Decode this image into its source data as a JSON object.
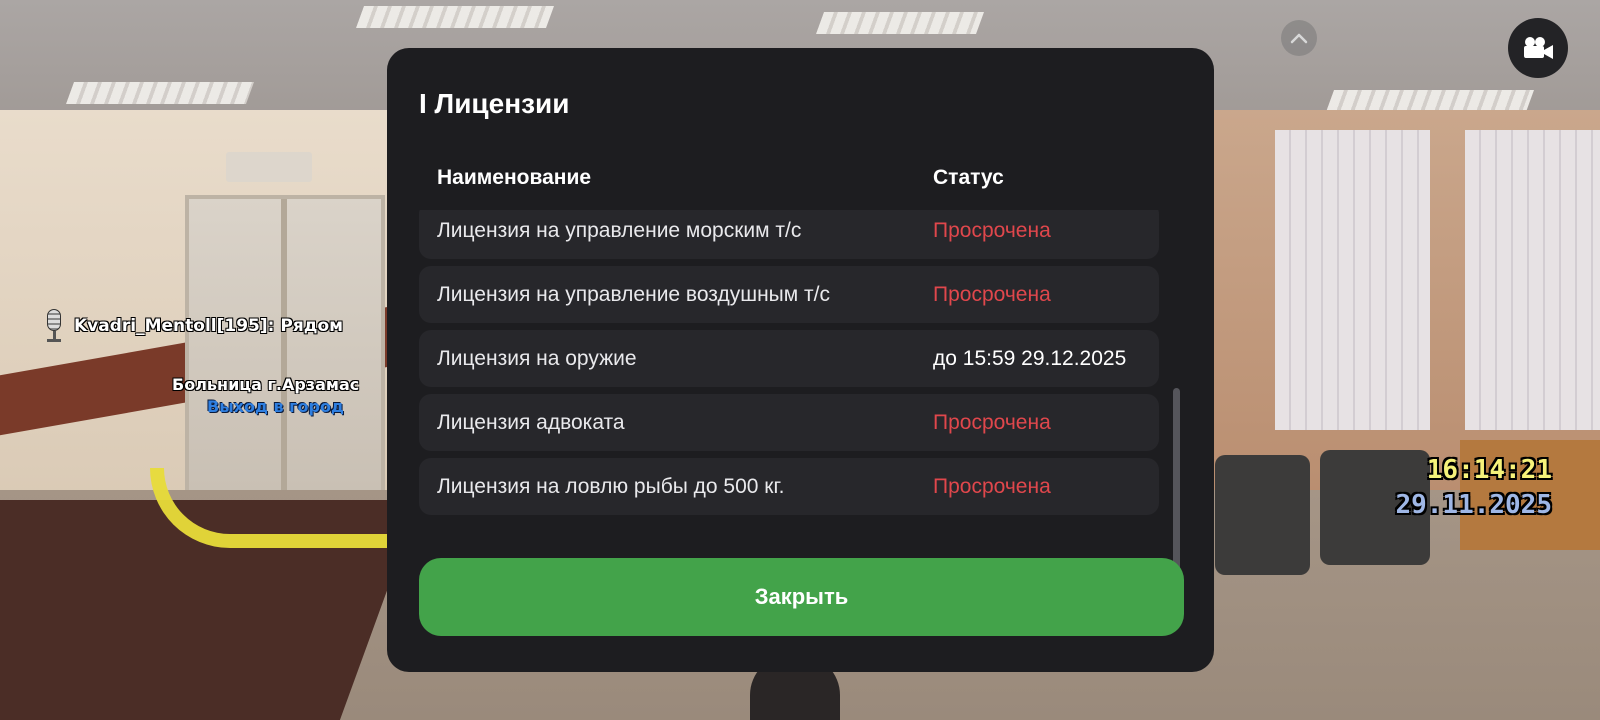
{
  "hud": {
    "player_label": "Kvadri_Mentoll[195]: Рядом",
    "location": "Больница г.Арзамас",
    "exit_label": "Выход в город",
    "time": "16:14:21",
    "date": "29.11.2025",
    "icons": {
      "mic": "microphone-icon",
      "chevron": "chevron-up-icon",
      "camera": "video-camera-icon"
    }
  },
  "modal": {
    "title": "I Лицензии",
    "headers": {
      "name": "Наименование",
      "status": "Статус"
    },
    "rows": [
      {
        "name": "Лицензия на управление морским т/с",
        "status": "Просрочена",
        "expired": true
      },
      {
        "name": "Лицензия на управление воздушным т/с",
        "status": "Просрочена",
        "expired": true
      },
      {
        "name": "Лицензия на оружие",
        "status": "до 15:59 29.12.2025",
        "expired": false
      },
      {
        "name": "Лицензия адвоката",
        "status": "Просрочена",
        "expired": true
      },
      {
        "name": "Лицензия на ловлю рыбы до 500 кг.",
        "status": "Просрочена",
        "expired": true
      }
    ],
    "close_label": "Закрыть"
  },
  "colors": {
    "expired": "#e0474c",
    "valid": "#ffffff",
    "close_button": "#43a34a",
    "modal_bg": "#1d1d20",
    "row_bg": "#27272b"
  }
}
